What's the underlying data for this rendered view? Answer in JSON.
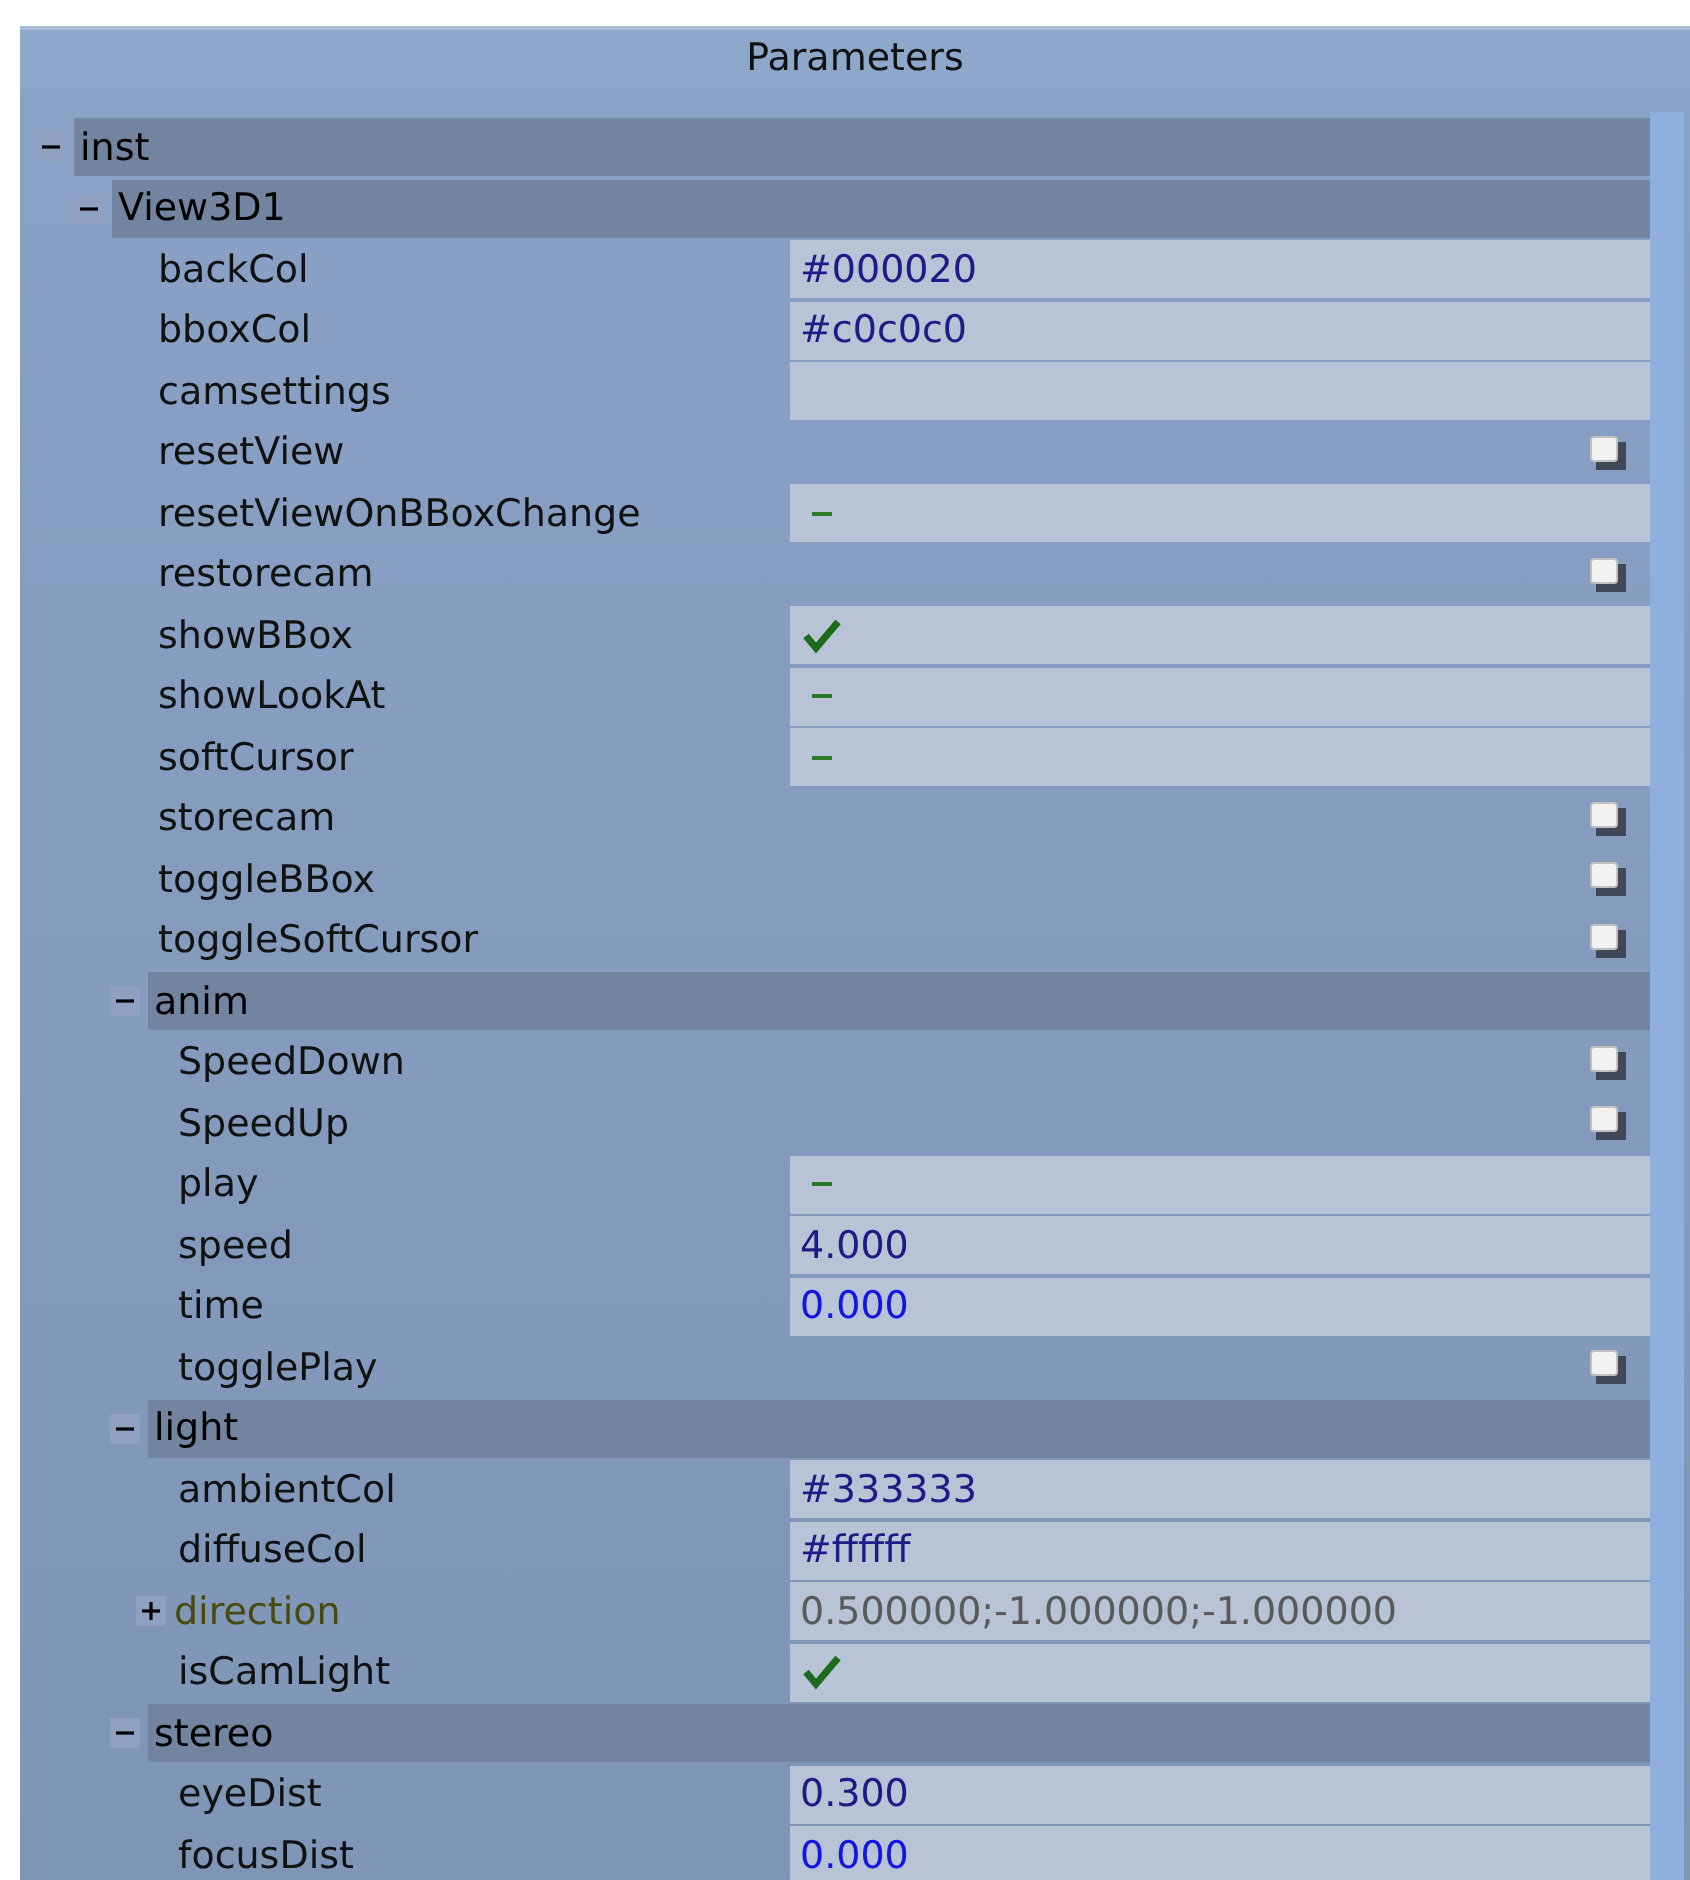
{
  "panel": {
    "title": "Parameters"
  },
  "tree": [
    {
      "label": "inst",
      "expanded": true,
      "children": [
        {
          "label": "View3D1",
          "expanded": true,
          "children": [
            {
              "kind": "text",
              "label": "backCol",
              "value": "#000020",
              "color": "#1c1c86"
            },
            {
              "kind": "text",
              "label": "bboxCol",
              "value": "#c0c0c0",
              "color": "#1c1c86"
            },
            {
              "kind": "text",
              "label": "camsettings"
            },
            {
              "kind": "button",
              "label": "resetView"
            },
            {
              "kind": "bool",
              "label": "resetViewOnBBoxChange",
              "checked": false
            },
            {
              "kind": "button",
              "label": "restorecam"
            },
            {
              "kind": "bool",
              "label": "showBBox",
              "checked": true
            },
            {
              "kind": "bool",
              "label": "showLookAt",
              "checked": false
            },
            {
              "kind": "bool",
              "label": "softCursor",
              "checked": false
            },
            {
              "kind": "button",
              "label": "storecam"
            },
            {
              "kind": "button",
              "label": "toggleBBox"
            },
            {
              "kind": "button",
              "label": "toggleSoftCursor"
            },
            {
              "label": "anim",
              "expanded": true,
              "children": [
                {
                  "kind": "button",
                  "label": "SpeedDown"
                },
                {
                  "kind": "button",
                  "label": "SpeedUp"
                },
                {
                  "kind": "bool",
                  "label": "play",
                  "checked": false
                },
                {
                  "kind": "text",
                  "label": "speed",
                  "value": "4.000",
                  "color": "#1c1c86"
                },
                {
                  "kind": "text",
                  "label": "time",
                  "value": "0.000",
                  "color": "#1414e6"
                },
                {
                  "kind": "button",
                  "label": "togglePlay"
                }
              ]
            },
            {
              "label": "light",
              "expanded": true,
              "children": [
                {
                  "kind": "text",
                  "label": "ambientCol",
                  "value": "#333333",
                  "color": "#1c1c86"
                },
                {
                  "kind": "text",
                  "label": "diffuseCol",
                  "value": "#ffffff",
                  "color": "#1c1c86"
                },
                {
                  "kind": "vector",
                  "label": "direction",
                  "value": "0.500000;-1.000000;-1.000000",
                  "expanded": false
                },
                {
                  "kind": "bool",
                  "label": "isCamLight",
                  "checked": true
                }
              ]
            },
            {
              "label": "stereo",
              "expanded": true,
              "children": [
                {
                  "kind": "text",
                  "label": "eyeDist",
                  "value": "0.300",
                  "color": "#1c1c86"
                },
                {
                  "kind": "text",
                  "label": "focusDist",
                  "value": "0.000",
                  "color": "#1414e6"
                }
              ]
            }
          ]
        }
      ]
    }
  ]
}
